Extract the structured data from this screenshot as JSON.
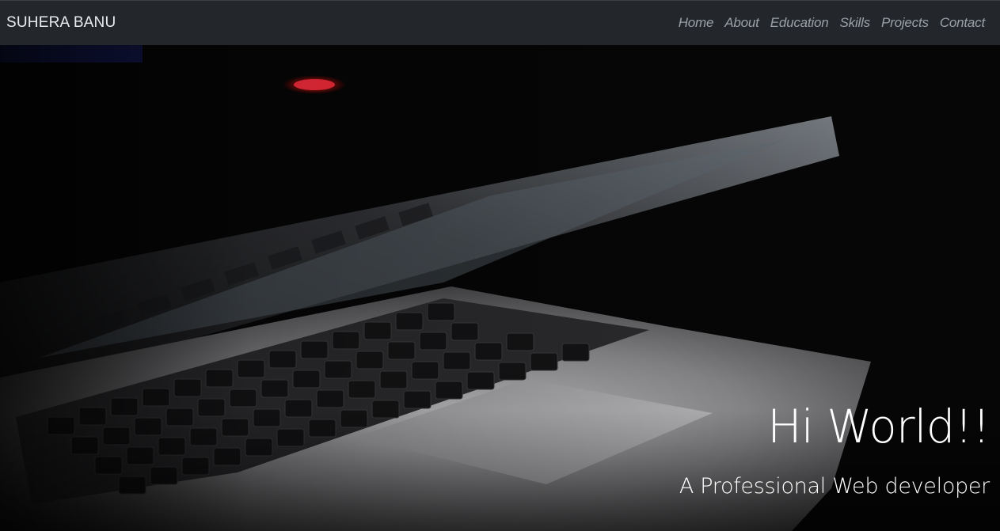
{
  "navbar": {
    "brand": "SUHERA BANU",
    "links": [
      {
        "label": "Home"
      },
      {
        "label": "About"
      },
      {
        "label": "Education"
      },
      {
        "label": "Skills"
      },
      {
        "label": "Projects"
      },
      {
        "label": "Contact"
      }
    ]
  },
  "hero": {
    "title": "Hi World!!",
    "subtitle": "A Professional Web developer",
    "background_image": "laptop-keyboard-photo"
  },
  "colors": {
    "navbar_bg": "#23272b",
    "brand_text": "#e9ecef",
    "nav_link_text": "#9aa0a6",
    "hero_text": "#ffffff"
  }
}
